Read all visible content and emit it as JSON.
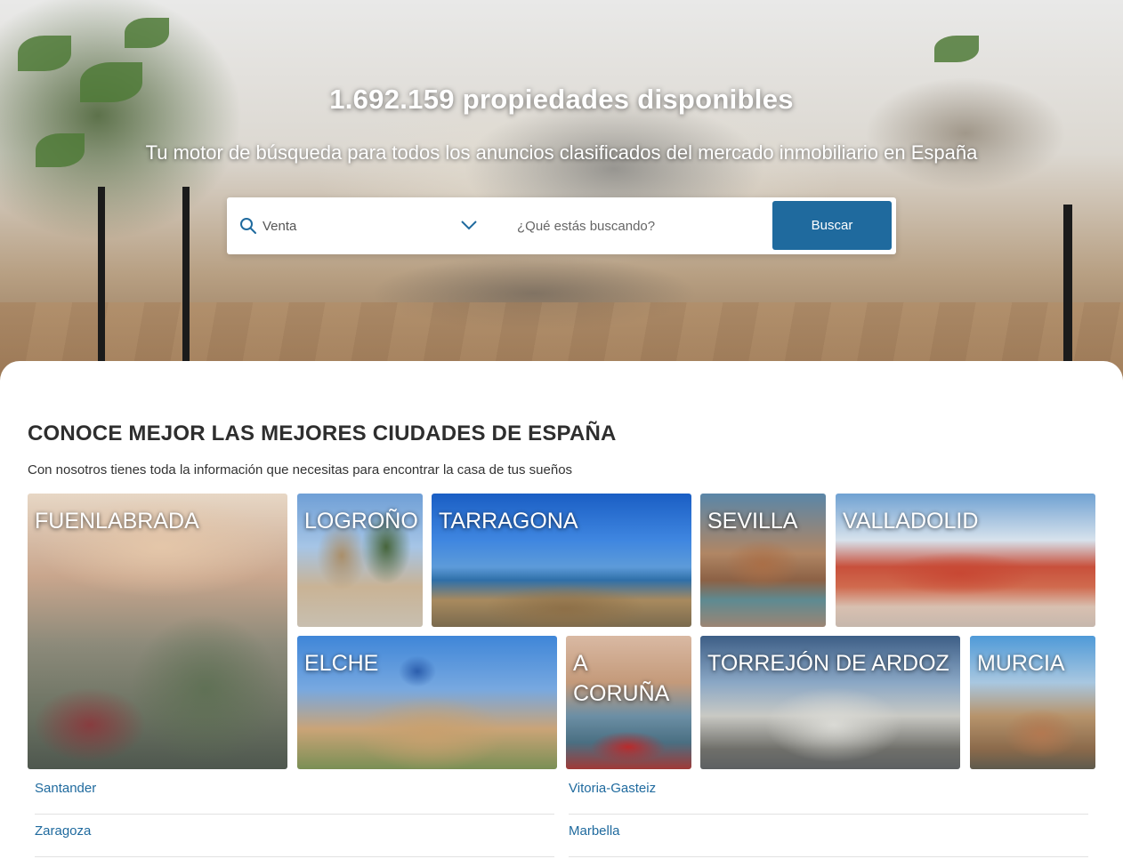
{
  "hero": {
    "title": "1.692.159 propiedades disponibles",
    "subtitle": "Tu motor de búsqueda para todos los anuncios clasificados del mercado inmobiliario en España"
  },
  "search": {
    "type_value": "Venta",
    "query_placeholder": "¿Qué estás buscando?",
    "button_label": "Buscar"
  },
  "cities_section": {
    "title": "CONOCE MEJOR LAS MEJORES CIUDADES DE ESPAÑA",
    "subtitle": "Con nosotros tienes toda la información que necesitas para encontrar la casa de tus sueños",
    "tiles": [
      {
        "name": "FUENLABRADA"
      },
      {
        "name": "LOGROÑO"
      },
      {
        "name": "TARRAGONA"
      },
      {
        "name": "SEVILLA"
      },
      {
        "name": "VALLADOLID"
      },
      {
        "name": "ELCHE"
      },
      {
        "name": "A CORUÑA"
      },
      {
        "name": "TORREJÓN DE ARDOZ"
      },
      {
        "name": "MURCIA"
      }
    ],
    "links": [
      {
        "label": "Santander"
      },
      {
        "label": "Vitoria-Gasteiz"
      },
      {
        "label": "Zaragoza"
      },
      {
        "label": "Marbella"
      }
    ]
  },
  "colors": {
    "accent": "#1f6a9e",
    "link": "#1f6a9e",
    "title_text": "#2e2e2e"
  },
  "icons": {
    "search_type": "search-icon",
    "dropdown": "chevron-down-icon"
  }
}
